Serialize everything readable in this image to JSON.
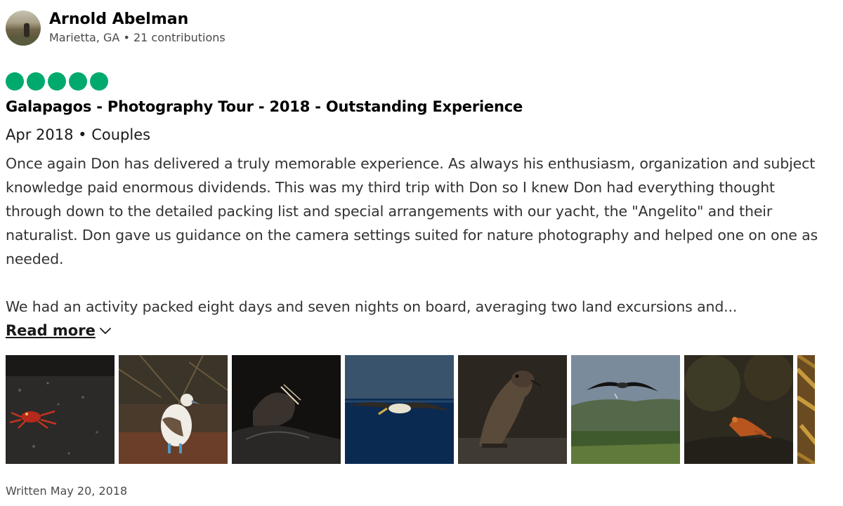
{
  "author": {
    "name": "Arnold Abelman",
    "location": "Marietta, GA",
    "separator": "•",
    "contributions": "21 contributions"
  },
  "rating": {
    "score": 5,
    "max": 5,
    "color": "#00aa6c"
  },
  "review": {
    "title": "Galapagos - Photography Tour - 2018 - Outstanding Experience",
    "visit_date": "Apr 2018",
    "separator": "•",
    "trip_type": "Couples",
    "paragraphs": [
      "Once again Don has delivered a truly memorable experience. As always his enthusiasm, organization and subject knowledge paid enormous dividends. This was my third trip with Don so I knew Don had everything thought through down to the detailed packing list and special arrangements with our yacht, the \"Angelito\" and their naturalist. Don gave us guidance on the camera settings suited for nature photography and helped one on one as needed.",
      "We had an activity packed eight days and seven nights on board, averaging two land excursions and..."
    ],
    "read_more_label": "Read more",
    "written_date": "Written May 20, 2018"
  },
  "photos": [
    {
      "subject": "sally-lightfoot-crab-photo"
    },
    {
      "subject": "blue-footed-booby-photo"
    },
    {
      "subject": "sea-lion-in-shadow-photo"
    },
    {
      "subject": "albatross-over-ocean-photo"
    },
    {
      "subject": "fur-seal-photo"
    },
    {
      "subject": "albatross-flying-photo"
    },
    {
      "subject": "lava-lizard-photo"
    },
    {
      "subject": "partial-photo"
    }
  ]
}
